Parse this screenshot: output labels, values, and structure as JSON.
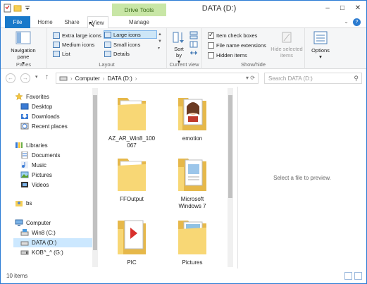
{
  "window": {
    "title": "DATA (D:)",
    "context_tab_header": "Drive Tools",
    "minimize_glyph": "–",
    "maximize_glyph": "□",
    "close_glyph": "✕"
  },
  "tabs": [
    "File",
    "Home",
    "Share",
    "View",
    "Manage"
  ],
  "ribbon": {
    "panes": {
      "label": "Panes",
      "navigation_pane": "Navigation pane",
      "nav_arrow": "▾"
    },
    "layout": {
      "label": "Layout",
      "options": [
        "Extra large icons",
        "Large icons",
        "Medium icons",
        "Small icons",
        "List",
        "Details"
      ],
      "selected": "Large icons"
    },
    "current_view": {
      "label": "Current view",
      "sort_by": "Sort by",
      "sort_arrow": "▾"
    },
    "show_hide": {
      "label": "Show/hide",
      "item_check_boxes": "Item check boxes",
      "item_check_boxes_checked": true,
      "file_name_extensions": "File name extensions",
      "file_name_extensions_checked": false,
      "hidden_items": "Hidden items",
      "hidden_items_checked": false,
      "hide_selected_items": "Hide selected items"
    },
    "options": {
      "label": "Options",
      "options_arrow": "▾"
    }
  },
  "navbar": {
    "back": "←",
    "forward": "→",
    "up": "↑",
    "breadcrumb": [
      "Computer",
      "DATA (D:)"
    ],
    "separator": "›",
    "search_placeholder": "Search DATA (D:)"
  },
  "nav_pane": {
    "favorites": "Favorites",
    "favorites_items": [
      "Desktop",
      "Downloads",
      "Recent places"
    ],
    "libraries": "Libraries",
    "libraries_items": [
      "Documents",
      "Music",
      "Pictures",
      "Videos"
    ],
    "bs": "bs",
    "computer": "Computer",
    "computer_items": [
      "Win8 (C:)",
      "DATA (D:)",
      "KOB^_^ (G:)"
    ],
    "selected": "DATA (D:)"
  },
  "files": [
    {
      "name": "AZ_AR_Win8_100067",
      "line1": "AZ_AR_Win8_100",
      "line2": "067",
      "type": "folder"
    },
    {
      "name": "emotion",
      "type": "folder-images"
    },
    {
      "name": "FFOutput",
      "type": "folder"
    },
    {
      "name": "Microsoft Windows 7",
      "line1": "Microsoft",
      "line2": "Windows 7",
      "type": "folder-docs"
    },
    {
      "name": "PIC",
      "type": "folder-pdf"
    },
    {
      "name": "Pictures",
      "type": "folder-images"
    }
  ],
  "preview_text": "Select a file to preview.",
  "status": {
    "item_count": "10 items"
  },
  "colors": {
    "accent": "#1979ca",
    "context_tab": "#c8e6a6",
    "folder": "#f8d775",
    "selection": "#cce8ff"
  }
}
